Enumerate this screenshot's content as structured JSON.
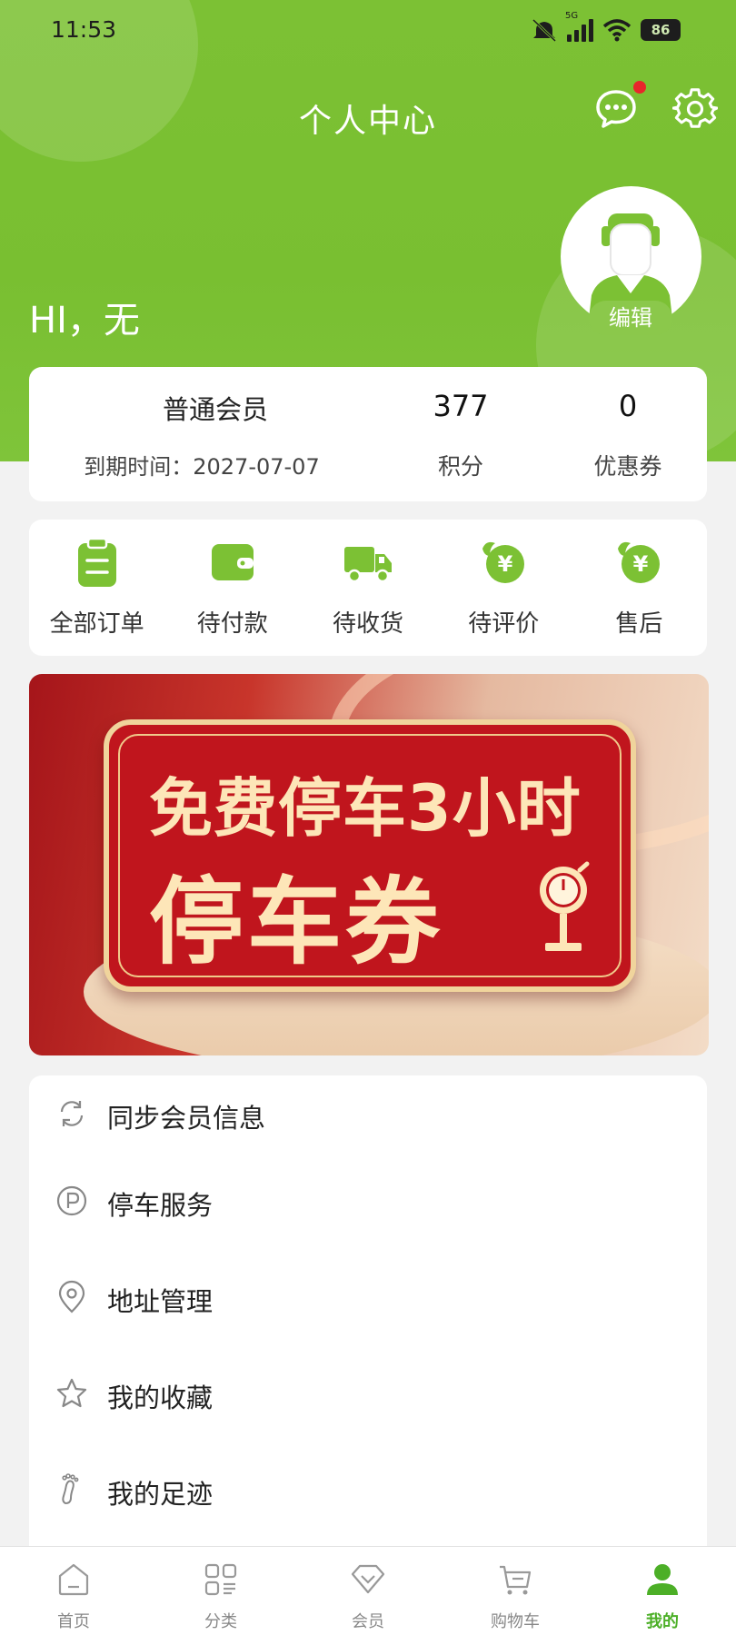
{
  "status_bar": {
    "time": "11:53",
    "network": "5G",
    "battery": "86"
  },
  "header": {
    "title": "个人中心",
    "greeting": "HI，无",
    "edit_label": "编辑"
  },
  "member": {
    "level": "普通会员",
    "expiry": "到期时间：2027-07-07",
    "points_value": "377",
    "points_label": "积分",
    "coupons_value": "0",
    "coupons_label": "优惠券"
  },
  "orders": [
    {
      "label": "全部订单",
      "icon": "clipboard-icon"
    },
    {
      "label": "待付款",
      "icon": "wallet-icon"
    },
    {
      "label": "待收货",
      "icon": "truck-icon"
    },
    {
      "label": "待评价",
      "icon": "yen-leaf-icon"
    },
    {
      "label": "售后",
      "icon": "yen-leaf-icon"
    }
  ],
  "banner": {
    "line1": "免费停车3小时",
    "line2": "停车券"
  },
  "menu": [
    {
      "label": "同步会员信息",
      "icon": "sync-icon"
    },
    {
      "label": "停车服务",
      "icon": "parking-icon"
    },
    {
      "label": "地址管理",
      "icon": "location-pin-icon"
    },
    {
      "label": "我的收藏",
      "icon": "star-icon"
    },
    {
      "label": "我的足迹",
      "icon": "footprint-icon"
    }
  ],
  "tabs": [
    {
      "label": "首页",
      "icon": "home-icon",
      "active": false
    },
    {
      "label": "分类",
      "icon": "category-icon",
      "active": false
    },
    {
      "label": "会员",
      "icon": "member-icon",
      "active": false
    },
    {
      "label": "购物车",
      "icon": "cart-icon",
      "active": false
    },
    {
      "label": "我的",
      "icon": "profile-icon",
      "active": true
    }
  ],
  "colors": {
    "brand_green": "#7cc134",
    "active_tab": "#4caf27",
    "badge_red": "#e8262b",
    "banner_red": "#c0151d"
  }
}
